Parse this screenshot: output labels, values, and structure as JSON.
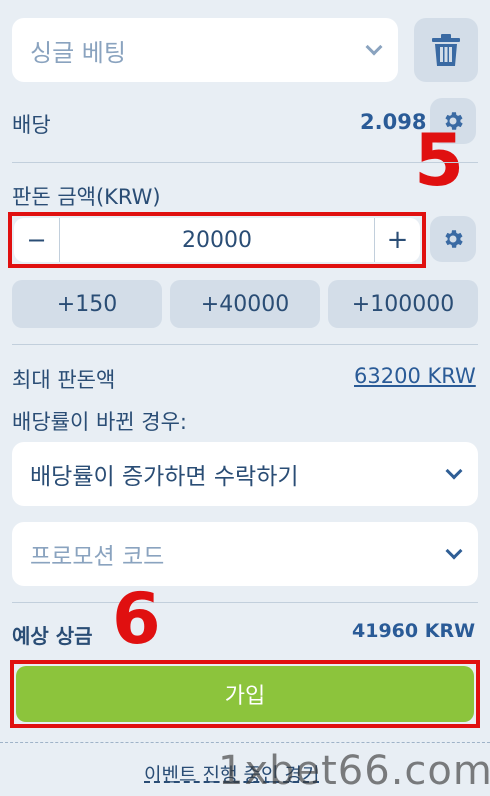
{
  "bet_type": {
    "value": "싱글 베팅"
  },
  "odds": {
    "label": "배당",
    "value": "2.098"
  },
  "stake": {
    "label": "판돈 금액(KRW)",
    "value": "20000",
    "minus": "−",
    "plus": "+"
  },
  "quick_amounts": [
    "+150",
    "+40000",
    "+100000"
  ],
  "max_stake": {
    "label": "최대 판돈액",
    "value": "63200 KRW"
  },
  "odds_change": {
    "label": "배당률이 바뀐 경우:",
    "value": "배당률이 증가하면 수락하기"
  },
  "promo": {
    "placeholder": "프로모션 코드"
  },
  "potential": {
    "label": "예상 상금",
    "value": "41960 KRW"
  },
  "submit": {
    "label": "가입"
  },
  "annotations": {
    "step5": "5",
    "step6": "6"
  },
  "footer": {
    "text": "이벤트 진행 중인 경기",
    "watermark": "1xbet66.com"
  },
  "colors": {
    "accent": "#2a5b97",
    "submit_green": "#8cc43c",
    "annotation_red": "#e01010",
    "background": "#e8eef4"
  }
}
